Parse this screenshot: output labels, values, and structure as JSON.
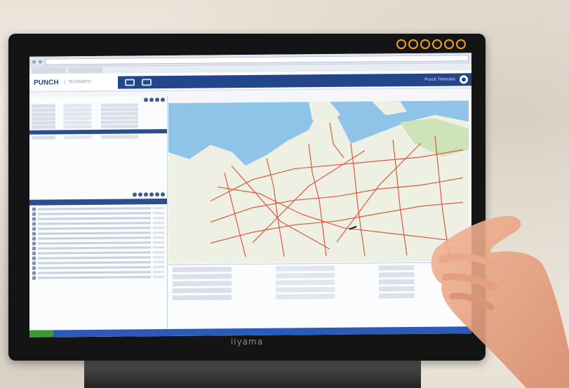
{
  "monitor": {
    "brand": "iiyama",
    "screen_title": "PUNCH Telematix"
  },
  "app": {
    "logo": "PUNCH",
    "logo_sub": "TELEMATIX",
    "user": "Punch Telematix"
  },
  "colors": {
    "accent": "#23468a",
    "road": "#d94a2a",
    "sea": "#8fc4e8",
    "land": "#eef0e4"
  }
}
